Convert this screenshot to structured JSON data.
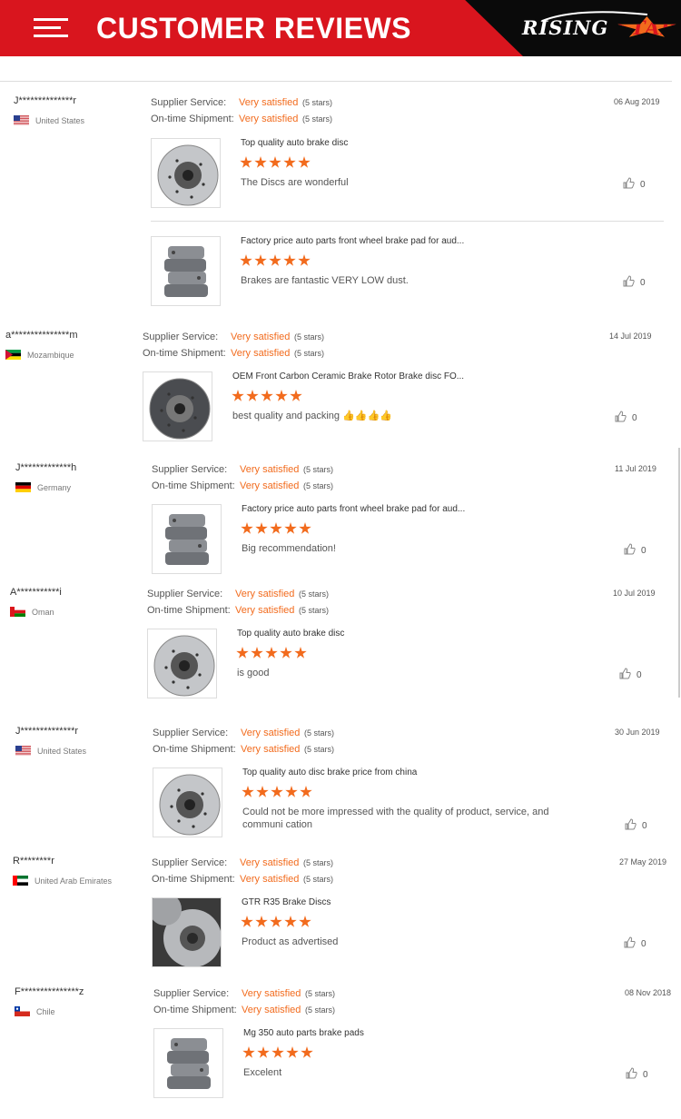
{
  "header": {
    "title": "CUSTOMER REVIEWS",
    "logo_left": "RISING",
    "logo_right": "STAR"
  },
  "labels": {
    "supplier_service": "Supplier Service:",
    "on_time_shipment": "On-time Shipment:"
  },
  "colors": {
    "banner_red": "#d9151e",
    "rating_orange": "#f26b1d"
  },
  "reviews": [
    {
      "user": "J**************r",
      "country": "United States",
      "flag": "us",
      "date": "06 Aug 2019",
      "supplier_service": "Very satisfied",
      "supplier_stars": "(5 stars)",
      "shipment": "Very satisfied",
      "shipment_stars": "(5 stars)",
      "items": [
        {
          "product": "Top quality auto brake disc",
          "stars": 5,
          "comment": "The Discs are wonderful",
          "likes": "0",
          "image": "brake-disc"
        },
        {
          "product": "Factory price auto parts front wheel brake pad for aud...",
          "stars": 5,
          "comment": "Brakes are fantastic VERY LOW dust.",
          "likes": "0",
          "image": "brake-pads"
        }
      ]
    },
    {
      "user": "a***************m",
      "country": "Mozambique",
      "flag": "mz",
      "date": "14 Jul 2019",
      "supplier_service": "Very satisfied",
      "supplier_stars": "(5 stars)",
      "shipment": "Very satisfied",
      "shipment_stars": "(5 stars)",
      "items": [
        {
          "product": "OEM Front Carbon Ceramic Brake Rotor Brake disc FO...",
          "stars": 5,
          "comment": "best quality and packing 👍👍👍👍",
          "likes": "0",
          "image": "ceramic-rotor"
        }
      ]
    },
    {
      "user": "J*************h",
      "country": "Germany",
      "flag": "de",
      "date": "11 Jul 2019",
      "supplier_service": "Very satisfied",
      "supplier_stars": "(5 stars)",
      "shipment": "Very satisfied",
      "shipment_stars": "(5 stars)",
      "items": [
        {
          "product": "Factory price auto parts front wheel brake pad for aud...",
          "stars": 5,
          "comment": "Big recommendation!",
          "likes": "0",
          "image": "brake-pads"
        }
      ]
    },
    {
      "user": "A***********i",
      "country": "Oman",
      "flag": "om",
      "date": "10 Jul 2019",
      "supplier_service": "Very satisfied",
      "supplier_stars": "(5 stars)",
      "shipment": "Very satisfied",
      "shipment_stars": "(5 stars)",
      "items": [
        {
          "product": "Top quality auto brake disc",
          "stars": 5,
          "comment": "is good",
          "likes": "0",
          "image": "brake-disc"
        }
      ]
    },
    {
      "user": "J**************r",
      "country": "United States",
      "flag": "us",
      "date": "30 Jun 2019",
      "supplier_service": "Very satisfied",
      "supplier_stars": "(5 stars)",
      "shipment": "Very satisfied",
      "shipment_stars": "(5 stars)",
      "items": [
        {
          "product": "Top quality auto disc brake price from china",
          "stars": 5,
          "comment": "Could not be more impressed with the quality of product, service, and communi cation",
          "likes": "0",
          "image": "drilled-disc"
        }
      ]
    },
    {
      "user": "R********r",
      "country": "United Arab Emirates",
      "flag": "ae",
      "date": "27 May 2019",
      "supplier_service": "Very satisfied",
      "supplier_stars": "(5 stars)",
      "shipment": "Very satisfied",
      "shipment_stars": "(5 stars)",
      "items": [
        {
          "product": "GTR R35 Brake Discs",
          "stars": 5,
          "comment": "Product as advertised",
          "likes": "0",
          "image": "gtr-discs"
        }
      ]
    },
    {
      "user": "F***************z",
      "country": "Chile",
      "flag": "cl",
      "date": "08 Nov 2018",
      "supplier_service": "Very satisfied",
      "supplier_stars": "(5 stars)",
      "shipment": "Very satisfied",
      "shipment_stars": "(5 stars)",
      "items": [
        {
          "product": "Mg 350 auto parts brake pads",
          "stars": 5,
          "comment": "Excelent",
          "likes": "0",
          "image": "rear-pads"
        }
      ]
    }
  ]
}
